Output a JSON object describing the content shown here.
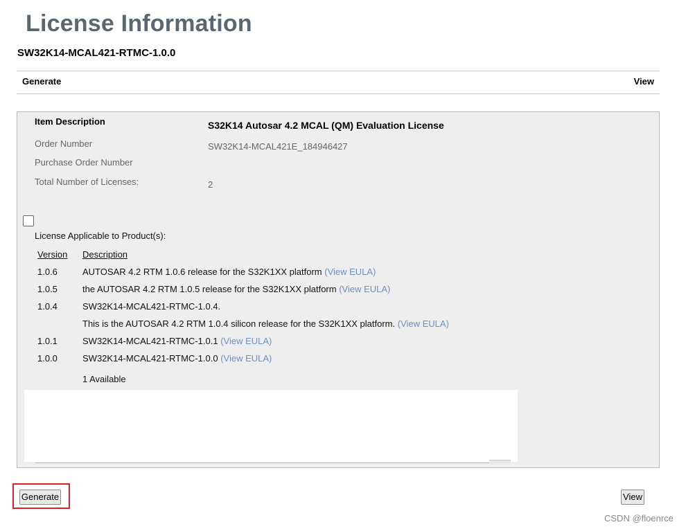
{
  "page": {
    "title": "License Information",
    "product": "SW32K14-MCAL421-RTMC-1.0.0"
  },
  "tabs": {
    "generate": "Generate",
    "view": "View"
  },
  "details": {
    "item_description_label": "Item Description",
    "item_description_value": "S32K14 Autosar 4.2 MCAL (QM) Evaluation License",
    "order_number_label": "Order Number",
    "order_number_value": "SW32K14-MCAL421E_184946427",
    "po_number_label": "Purchase Order Number",
    "total_licenses_label": "Total Number of Licenses:",
    "total_licenses_value": "2"
  },
  "products": {
    "applicable_label": "License Applicable to Product(s):",
    "col_version": "Version",
    "col_description": "Description",
    "eula_link": "(View EULA)",
    "rows": [
      {
        "version": "1.0.6",
        "description": "AUTOSAR 4.2 RTM 1.0.6 release for the S32K1XX platform"
      },
      {
        "version": "1.0.5",
        "description": "the AUTOSAR 4.2 RTM 1.0.5 release for the S32K1XX platform"
      },
      {
        "version": "1.0.4",
        "description": "SW32K14-MCAL421-RTMC-1.0.4.",
        "description2": "This is the AUTOSAR 4.2 RTM 1.0.4 silicon release for the S32K1XX platform."
      },
      {
        "version": "1.0.1",
        "description": "SW32K14-MCAL421-RTMC-1.0.1"
      },
      {
        "version": "1.0.0",
        "description": "SW32K14-MCAL421-RTMC-1.0.0"
      }
    ],
    "available": "1 Available"
  },
  "buttons": {
    "generate": "Generate",
    "view": "View"
  },
  "watermark": "CSDN @floenrce",
  "colors": {
    "title": "#5a6670",
    "link": "#6a8fc4",
    "panel_bg": "#eeeeee",
    "highlight": "#d8232a"
  }
}
